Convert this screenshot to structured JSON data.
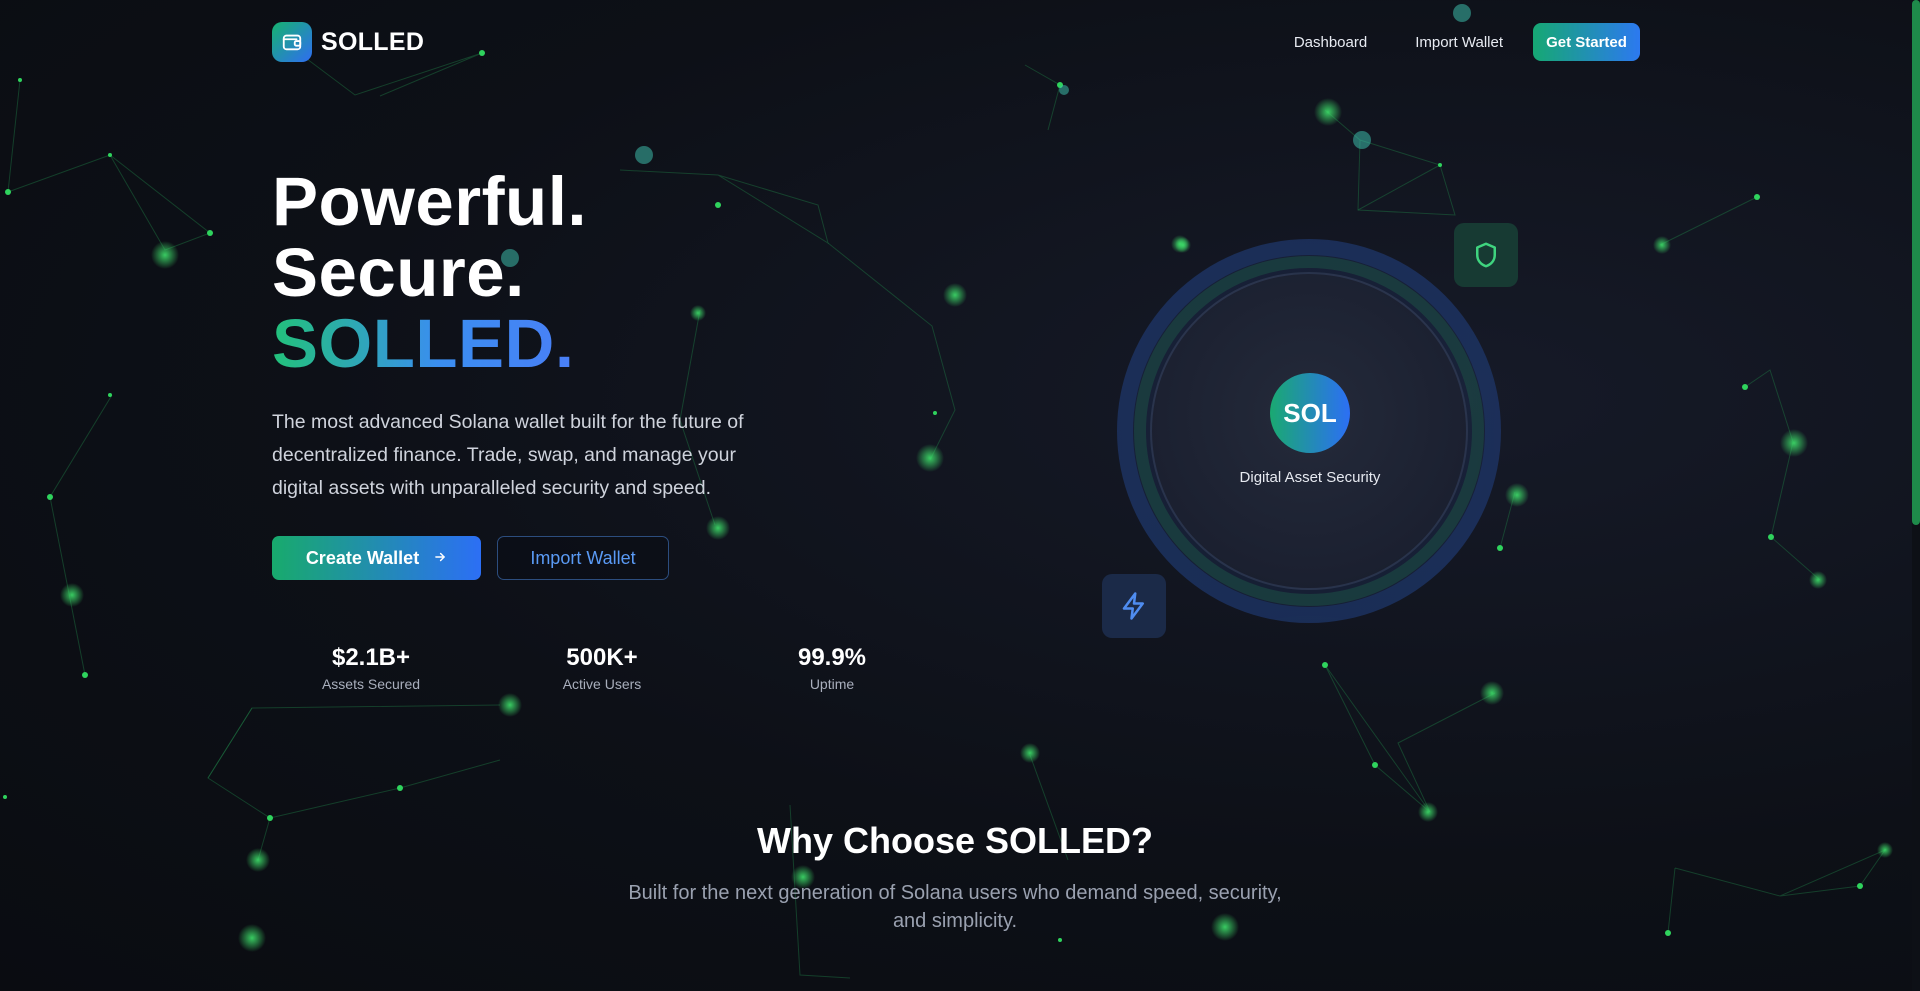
{
  "brand": {
    "name": "SOLLED",
    "logo_icon": "wallet-icon",
    "accent_green": "#16b36f",
    "accent_blue": "#2f6df2"
  },
  "nav": {
    "dashboard": "Dashboard",
    "import_wallet": "Import Wallet",
    "get_started": "Get Started"
  },
  "hero": {
    "line1": "Powerful.",
    "line2": "Secure.",
    "line3": "SOLLED.",
    "description": "The most advanced Solana wallet built for the future of decentralized finance. Trade, swap, and manage your digital assets with unparalleled security and speed.",
    "create_wallet": "Create Wallet",
    "create_wallet_icon": "arrow-right-icon",
    "import_wallet": "Import Wallet"
  },
  "stats": [
    {
      "value": "$2.1B+",
      "label": "Assets Secured"
    },
    {
      "value": "500K+",
      "label": "Active Users"
    },
    {
      "value": "99.9%",
      "label": "Uptime"
    }
  ],
  "orb": {
    "badge": "SOL",
    "caption": "Digital Asset Security",
    "chip_top_icon": "shield-icon",
    "chip_bottom_icon": "lightning-bolt-icon"
  },
  "features_section": {
    "title": "Why Choose SOLLED?",
    "subtitle": "Built for the next generation of Solana users who demand speed, security, and simplicity."
  }
}
